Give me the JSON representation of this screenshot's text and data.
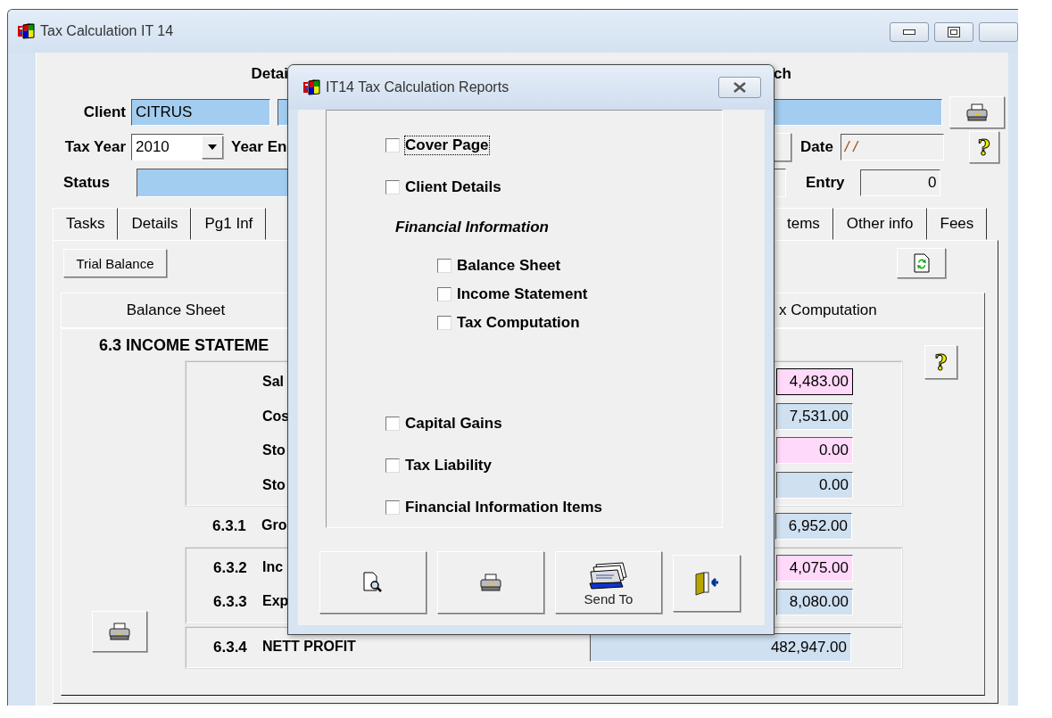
{
  "window": {
    "title": "Tax Calculation IT 14"
  },
  "header": {
    "left_heading": "Detai",
    "right_heading": "ch"
  },
  "client": {
    "label": "Client",
    "value": "CITRUS"
  },
  "tax_year": {
    "label": "Tax Year",
    "value": "2010",
    "year_end_label": "Year En"
  },
  "status": {
    "label": "Status"
  },
  "date": {
    "label": "Date",
    "value": "/ /"
  },
  "entry": {
    "label": "Entry",
    "value": "0"
  },
  "help_button": "?",
  "tabs": [
    {
      "label": "Tasks",
      "selected": false
    },
    {
      "label": "Details",
      "selected": false
    },
    {
      "label": "Pg1 Inf",
      "selected": false
    },
    {
      "label": "tems",
      "selected": false
    },
    {
      "label": "Other info",
      "selected": false
    },
    {
      "label": "Fees",
      "selected": false
    }
  ],
  "trial_balance_button": "Trial Balance",
  "sub_tabs": [
    {
      "label": "Balance Sheet",
      "selected": false
    },
    {
      "label": "x Computation",
      "selected": false
    }
  ],
  "income_statement": {
    "heading": "6.3 INCOME STATEME",
    "help_button": "?",
    "groups": [
      {
        "framed": true,
        "rows": [
          {
            "number": "",
            "label": "Sal",
            "value": "4,483.00",
            "color": "#ffd9fa",
            "focused": true,
            "kind": "line"
          },
          {
            "number": "",
            "label": "Cos",
            "value": "7,531.00",
            "color": "#cfe0f1",
            "focused": false,
            "kind": "line"
          },
          {
            "number": "",
            "label": "Sto",
            "value": "0.00",
            "color": "#ffd9fa",
            "focused": false,
            "kind": "line"
          },
          {
            "number": "",
            "label": "Sto",
            "value": "0.00",
            "color": "#cfe0f1",
            "focused": false,
            "kind": "line"
          }
        ]
      },
      {
        "framed": false,
        "rows": [
          {
            "number": "6.3.1",
            "label": "Gro",
            "value": "6,952.00",
            "color": "#cfe0f1",
            "focused": false,
            "kind": "line"
          }
        ]
      },
      {
        "framed": true,
        "rows": [
          {
            "number": "6.3.2",
            "label": "Inc",
            "value": "4,075.00",
            "color": "#ffd9fa",
            "focused": false,
            "kind": "line"
          },
          {
            "number": "6.3.3",
            "label": "Exp",
            "value": "8,080.00",
            "color": "#cfe0f1",
            "focused": false,
            "kind": "line"
          }
        ]
      },
      {
        "framed": true,
        "rows": [
          {
            "number": "6.3.4",
            "label": "NETT PROFIT",
            "value": "482,947.00",
            "color": "#cfe0f1",
            "focused": false,
            "kind": "total"
          }
        ]
      }
    ]
  },
  "dialog": {
    "title": "IT14 Tax Calculation Reports",
    "options": [
      {
        "kind": "option",
        "label": "Cover Page",
        "checked": false,
        "focused": true
      },
      {
        "kind": "option",
        "label": "Client Details",
        "checked": false,
        "focused": false
      },
      {
        "kind": "heading",
        "label": "Financial Information",
        "children": [
          {
            "kind": "option",
            "label": "Balance Sheet",
            "checked": false,
            "focused": false
          },
          {
            "kind": "option",
            "label": "Income Statement",
            "checked": false,
            "focused": false
          },
          {
            "kind": "option",
            "label": "Tax Computation",
            "checked": false,
            "focused": false
          }
        ]
      },
      {
        "kind": "option",
        "label": "Capital Gains",
        "checked": false,
        "focused": false
      },
      {
        "kind": "option",
        "label": "Tax Liability",
        "checked": false,
        "focused": false
      },
      {
        "kind": "option",
        "label": "Financial Information Items",
        "checked": false,
        "focused": false
      }
    ],
    "buttons": [
      {
        "kind": "preview"
      },
      {
        "kind": "print"
      },
      {
        "kind": "send",
        "label": "Send To"
      },
      {
        "kind": "exit"
      }
    ]
  }
}
